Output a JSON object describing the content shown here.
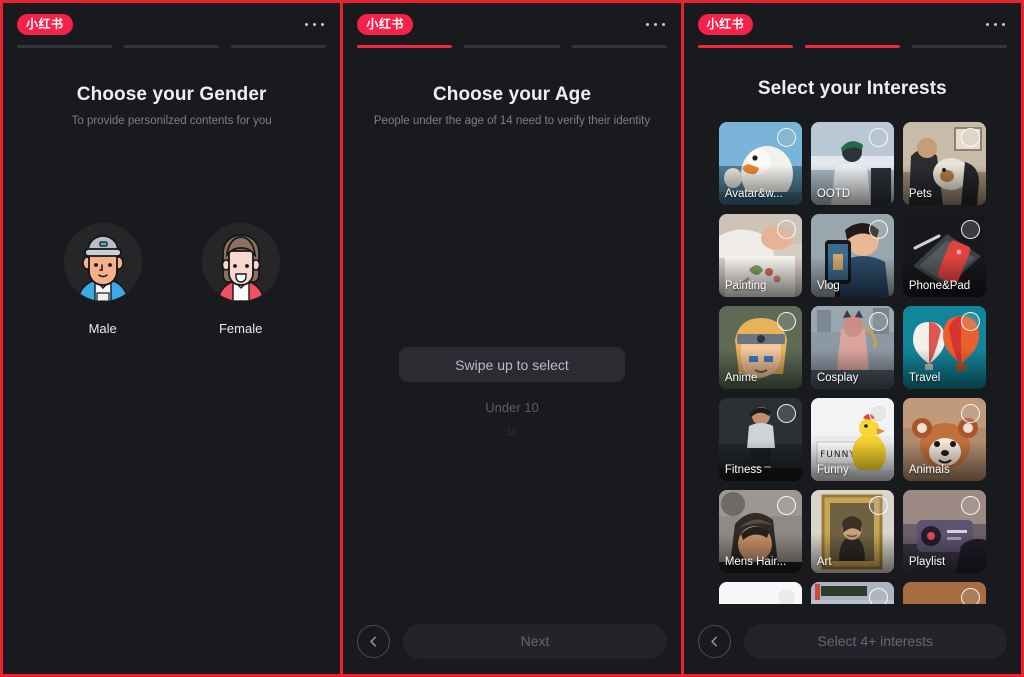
{
  "brand": {
    "logo_text": "小红书",
    "accent_color": "#f0273e",
    "bg_color": "#191a1e"
  },
  "overflow_menu": {
    "name": "more-options"
  },
  "screen_gender": {
    "progress": [
      false,
      false,
      false
    ],
    "title": "Choose your Gender",
    "subtitle": "To provide personilzed contents for you",
    "options": [
      {
        "id": "male",
        "label": "Male"
      },
      {
        "id": "female",
        "label": "Female"
      }
    ]
  },
  "screen_age": {
    "progress": [
      true,
      false,
      false
    ],
    "title": "Choose your Age",
    "subtitle": "People under the age of 14 need to verify their identity",
    "picker": {
      "hint": "Swipe up to select",
      "option_1": "Under 10",
      "option_2": "10"
    },
    "bottom": {
      "back": "back",
      "cta": "Next"
    }
  },
  "screen_interests": {
    "progress": [
      true,
      true,
      false
    ],
    "title": "Select your Interests",
    "tiles": [
      {
        "label": "Avatar&w...",
        "art": "duck",
        "selected": false
      },
      {
        "label": "OOTD",
        "art": "ootd",
        "selected": false
      },
      {
        "label": "Pets",
        "art": "pets",
        "selected": false
      },
      {
        "label": "Painting",
        "art": "painting",
        "selected": false
      },
      {
        "label": "Vlog",
        "art": "vlog",
        "selected": false
      },
      {
        "label": "Phone&Pad",
        "art": "phone",
        "selected": false
      },
      {
        "label": "Anime",
        "art": "anime",
        "selected": false
      },
      {
        "label": "Cosplay",
        "art": "cosplay",
        "selected": false
      },
      {
        "label": "Travel",
        "art": "travel",
        "selected": false
      },
      {
        "label": "Fitness",
        "art": "fitness",
        "selected": false
      },
      {
        "label": "Funny",
        "art": "funny",
        "selected": false
      },
      {
        "label": "Animals",
        "art": "animals",
        "selected": false
      },
      {
        "label": "Mens Hair...",
        "art": "hair",
        "selected": false
      },
      {
        "label": "Art",
        "art": "art",
        "selected": false
      },
      {
        "label": "Playlist",
        "art": "playlist",
        "selected": false
      },
      {
        "label": "",
        "art": "white",
        "selected": false
      },
      {
        "label": "",
        "art": "car",
        "selected": false
      },
      {
        "label": "",
        "art": "brown",
        "selected": false
      }
    ],
    "bottom": {
      "back": "back",
      "cta": "Select 4+ interests"
    }
  }
}
